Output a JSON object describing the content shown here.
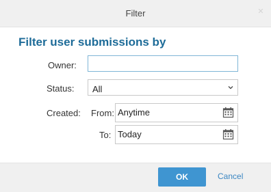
{
  "dialog": {
    "title": "Filter",
    "close_icon": "close-icon"
  },
  "form": {
    "heading": "Filter user submissions by",
    "owner": {
      "label": "Owner:",
      "value": ""
    },
    "status": {
      "label": "Status:",
      "selected": "All"
    },
    "created": {
      "label": "Created:",
      "from_label": "From:",
      "from_value": "Anytime",
      "to_label": "To:",
      "to_value": "Today"
    }
  },
  "footer": {
    "ok_label": "OK",
    "cancel_label": "Cancel"
  },
  "colors": {
    "heading": "#1d6b98",
    "ok_button": "#3f95d1",
    "cancel_link": "#3a86c2",
    "focus_border": "#7eb5d6"
  }
}
